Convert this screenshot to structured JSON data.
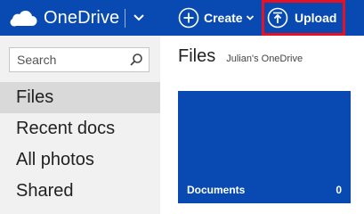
{
  "header": {
    "app_title": "OneDrive",
    "create_label": "Create",
    "upload_label": "Upload",
    "brand_color": "#094ab2",
    "highlight_color": "#e81123",
    "icons": {
      "logo": "cloud-icon",
      "app_menu": "chevron-down-icon",
      "create": "plus-circle-icon",
      "create_dropdown": "chevron-down-icon",
      "upload": "upload-arrow-circle-icon"
    }
  },
  "sidebar": {
    "search_placeholder": "Search",
    "search_icon": "search-icon",
    "items": [
      {
        "label": "Files",
        "active": true
      },
      {
        "label": "Recent docs",
        "active": false
      },
      {
        "label": "All photos",
        "active": false
      },
      {
        "label": "Shared",
        "active": false
      }
    ]
  },
  "main": {
    "title": "Files",
    "owner": "Julian's OneDrive",
    "tiles": [
      {
        "name": "Documents",
        "count": "0",
        "color": "#094ab2"
      }
    ]
  }
}
